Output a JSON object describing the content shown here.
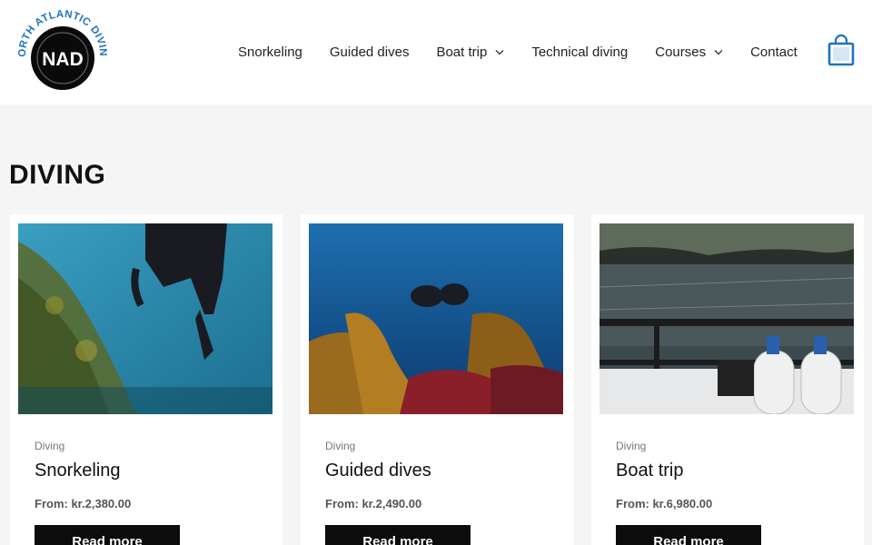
{
  "header": {
    "logo_text": "NORTH ATLANTIC DIVING",
    "logo_mark": "NAD",
    "nav": [
      {
        "label": "Snorkeling",
        "has_dropdown": false
      },
      {
        "label": "Guided dives",
        "has_dropdown": false
      },
      {
        "label": "Boat trip",
        "has_dropdown": true
      },
      {
        "label": "Technical diving",
        "has_dropdown": false
      },
      {
        "label": "Courses",
        "has_dropdown": true
      },
      {
        "label": "Contact",
        "has_dropdown": false
      }
    ],
    "cart_icon": "shopping-bag-icon"
  },
  "main": {
    "title": "DIVING",
    "products": [
      {
        "category": "Diving",
        "title": "Snorkeling",
        "price": "From: kr.2,380.00",
        "button": "Read more",
        "image": "snorkeler-underwater-photo"
      },
      {
        "category": "Diving",
        "title": "Guided dives",
        "price": "From: kr.2,490.00",
        "button": "Read more",
        "image": "divers-in-kelp-photo"
      },
      {
        "category": "Diving",
        "title": "Boat trip",
        "price": "From: kr.6,980.00",
        "button": "Read more",
        "image": "boat-with-tanks-photo"
      }
    ]
  },
  "colors": {
    "accent": "#1e73be",
    "button_bg": "#0c0c0c",
    "page_bg": "#f5f5f5"
  }
}
